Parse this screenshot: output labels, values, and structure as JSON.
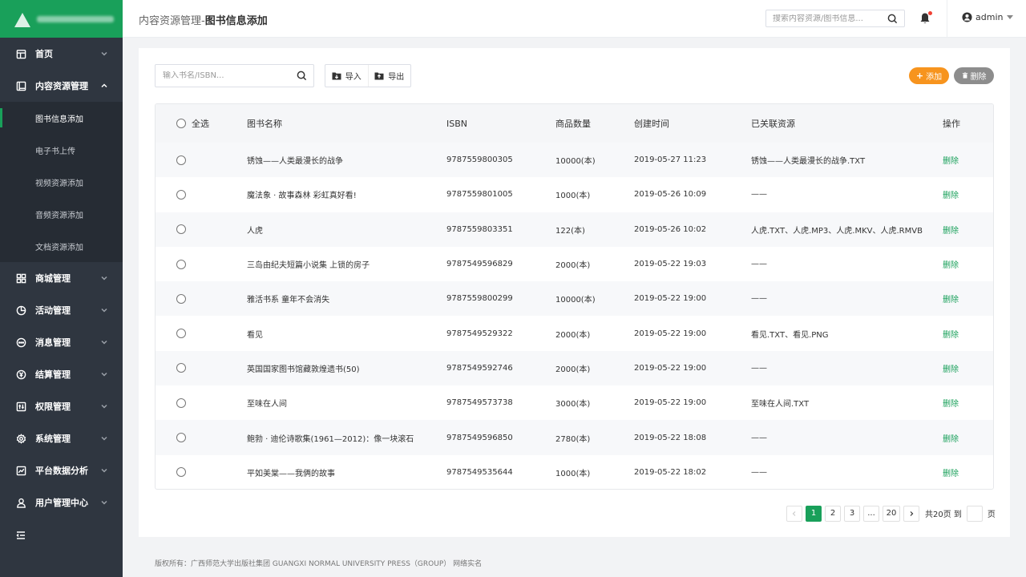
{
  "header": {
    "breadcrumb_parent": "内容资源管理-",
    "breadcrumb_current": "图书信息添加",
    "search_placeholder": "搜索内容资源/图书信息...",
    "username": "admin"
  },
  "sidebar": {
    "items": [
      {
        "label": "首页",
        "icon": "calendar-icon"
      },
      {
        "label": "内容资源管理",
        "icon": "content-icon",
        "expanded": true
      },
      {
        "label": "商城管理",
        "icon": "grid-icon"
      },
      {
        "label": "活动管理",
        "icon": "pie-icon"
      },
      {
        "label": "消息管理",
        "icon": "chat-icon"
      },
      {
        "label": "结算管理",
        "icon": "yen-icon"
      },
      {
        "label": "权限管理",
        "icon": "permission-icon"
      },
      {
        "label": "系统管理",
        "icon": "gear-icon"
      },
      {
        "label": "平台数据分析",
        "icon": "chart-icon"
      },
      {
        "label": "用户管理中心",
        "icon": "user-icon"
      }
    ],
    "subitems": [
      "图书信息添加",
      "电子书上传",
      "视频资源添加",
      "音频资源添加",
      "文档资源添加"
    ]
  },
  "toolbar": {
    "search_placeholder": "输入书名/ISBN...",
    "import_label": "导入",
    "export_label": "导出",
    "add_label": "添加",
    "delete_label": "删除"
  },
  "table": {
    "columns": {
      "select_all": "全选",
      "name": "图书名称",
      "isbn": "ISBN",
      "qty": "商品数量",
      "time": "创建时间",
      "resources": "已关联资源",
      "op": "操作"
    },
    "rows": [
      {
        "name": "锈蚀——人类最漫长的战争",
        "isbn": "9787559800305",
        "qty": "10000(本)",
        "time": "2019-05-27 11:23",
        "resources": "锈蚀——人类最漫长的战争.TXT",
        "op": "删除"
      },
      {
        "name": "魔法象 · 故事森林 彩虹真好看!",
        "isbn": "9787559801005",
        "qty": "1000(本)",
        "time": "2019-05-26 10:09",
        "resources": "——",
        "op": "删除"
      },
      {
        "name": "人虎",
        "isbn": "9787559803351",
        "qty": "122(本)",
        "time": "2019-05-26 10:02",
        "resources": "人虎.TXT、人虎.MP3、人虎.MKV、人虎.RMVB",
        "op": "删除"
      },
      {
        "name": "三岛由纪夫短篇小说集 上锁的房子",
        "isbn": "9787549596829",
        "qty": "2000(本)",
        "time": "2019-05-22 19:03",
        "resources": "——",
        "op": "删除"
      },
      {
        "name": "雅活书系 童年不会消失",
        "isbn": "9787559800299",
        "qty": "10000(本)",
        "time": "2019-05-22 19:00",
        "resources": "——",
        "op": "删除"
      },
      {
        "name": "看见",
        "isbn": "9787549529322",
        "qty": "2000(本)",
        "time": "2019-05-22 19:00",
        "resources": "看见.TXT、看见.PNG",
        "op": "删除"
      },
      {
        "name": "英国国家图书馆藏敦煌遗书(50)",
        "isbn": "9787549592746",
        "qty": "2000(本)",
        "time": "2019-05-22 19:00",
        "resources": "——",
        "op": "删除"
      },
      {
        "name": "至味在人间",
        "isbn": "9787549573738",
        "qty": "3000(本)",
        "time": "2019-05-22 19:00",
        "resources": "至味在人间.TXT",
        "op": "删除"
      },
      {
        "name": "鲍勃 · 迪伦诗歌集(1961—2012)：像一块滚石",
        "isbn": "9787549596850",
        "qty": "2780(本)",
        "time": "2019-05-22 18:08",
        "resources": "——",
        "op": "删除"
      },
      {
        "name": "平如美棠——我俩的故事",
        "isbn": "9787549535644",
        "qty": "1000(本)",
        "time": "2019-05-22 18:02",
        "resources": "——",
        "op": "删除"
      }
    ]
  },
  "pagination": {
    "pages": [
      "1",
      "2",
      "3",
      "...",
      "20"
    ],
    "current": "1",
    "total_text": "共20页",
    "goto_text": "到",
    "page_suffix": "页"
  },
  "footer": {
    "text": "版权所有：广西师范大学出版社集团 GUANGXI NORMAL UNIVERSITY PRESS（GROUP） 网络实名"
  },
  "colors": {
    "brand": "#19a05a",
    "sidebar": "#2f3640",
    "add": "#f7941e",
    "delete": "#8d8d8d"
  }
}
